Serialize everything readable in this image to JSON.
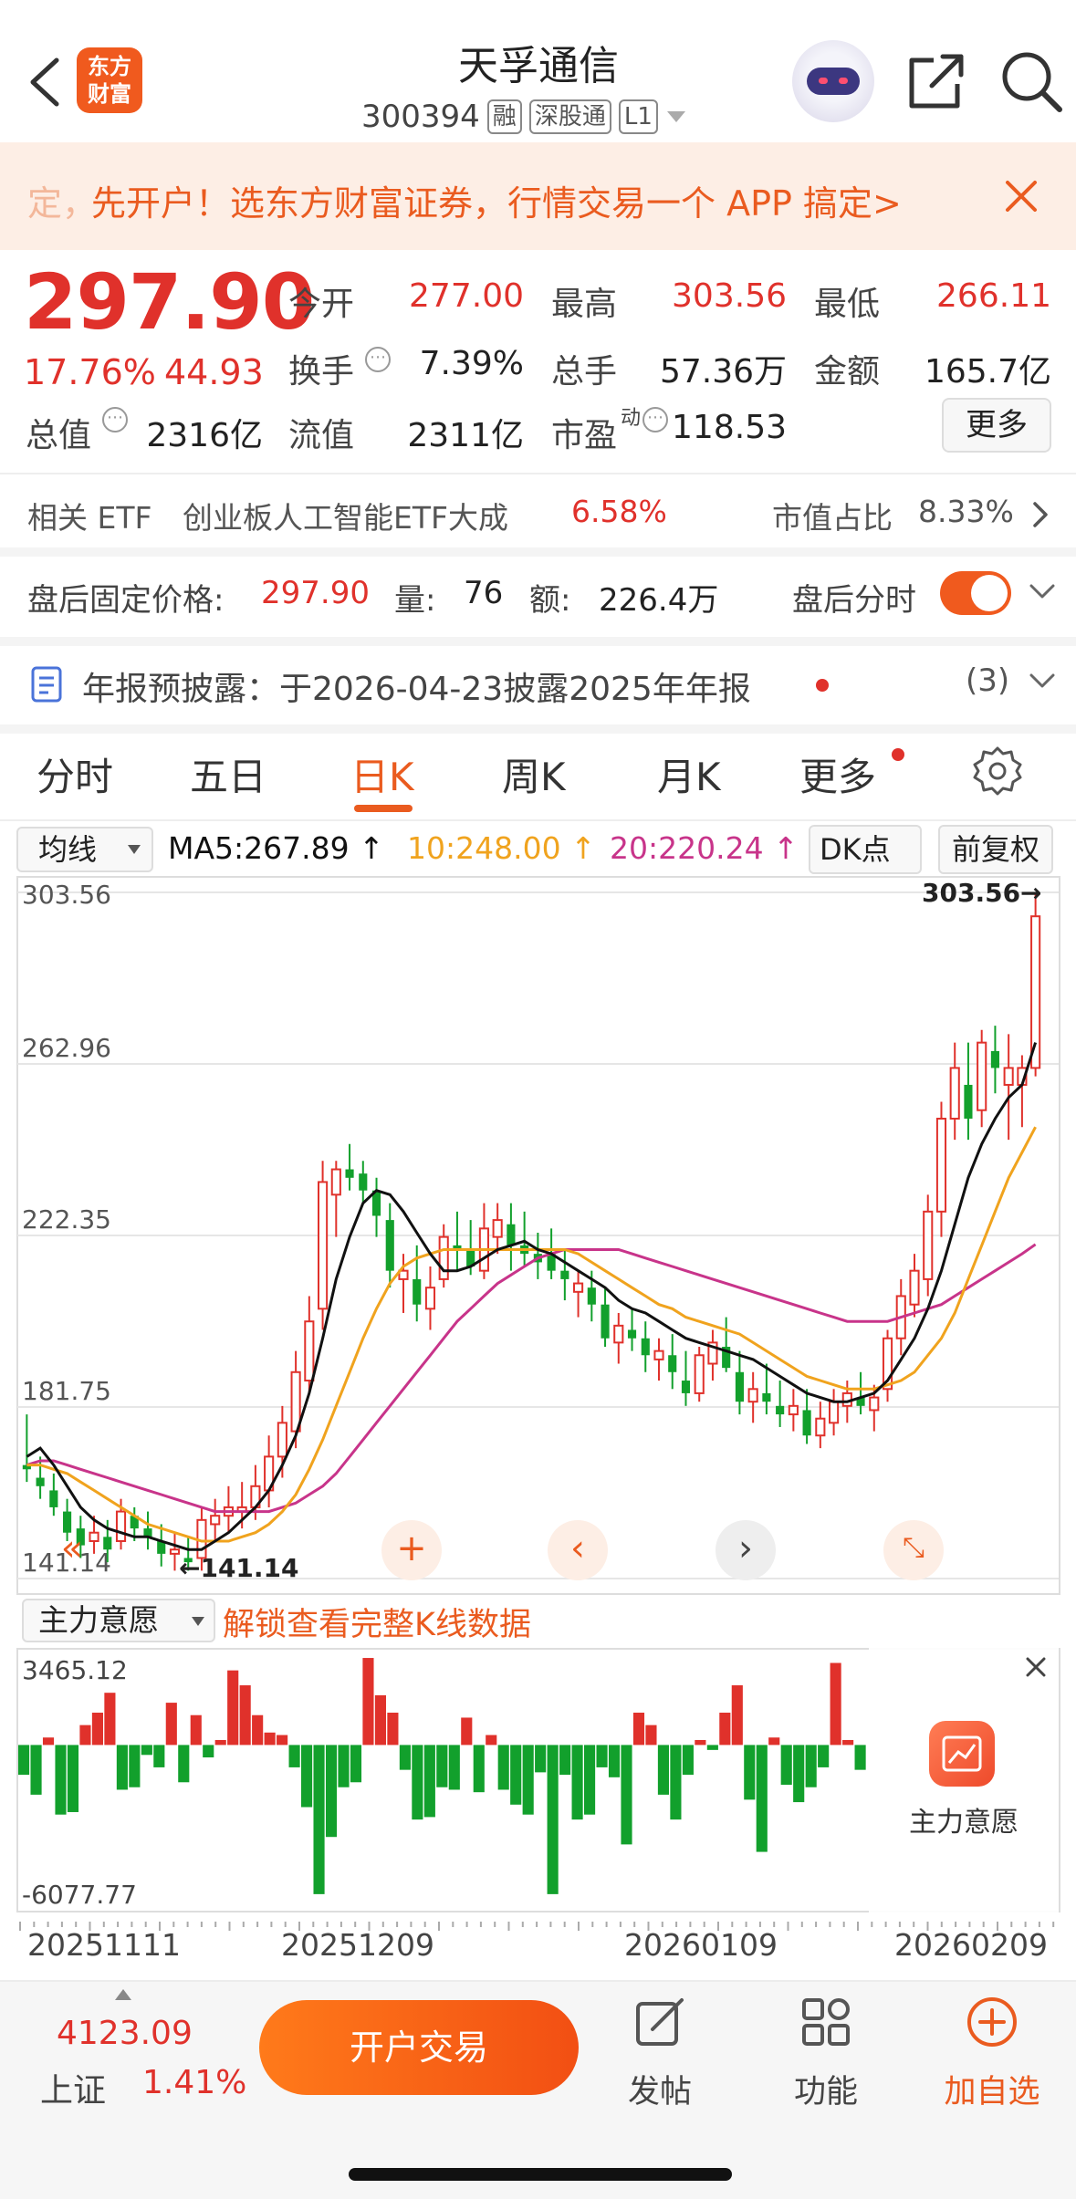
{
  "header": {
    "title": "天孚通信",
    "code": "300394",
    "tags": [
      "融",
      "深股通",
      "L1"
    ],
    "logo_text": [
      "东方",
      "财富"
    ]
  },
  "banner": {
    "text": "先开户！选东方财富证券，行情交易一个 APP 搞定>",
    "leading": "定，"
  },
  "quote": {
    "price": "297.90",
    "change_pct": "17.76%",
    "change_abs": "44.93",
    "fields": {
      "open_label": "今开",
      "open": "277.00",
      "high_label": "最高",
      "high": "303.56",
      "low_label": "最低",
      "low": "266.11",
      "turnover_label": "换手",
      "turnover": "7.39%",
      "volume_label": "总手",
      "volume": "57.36万",
      "amount_label": "金额",
      "amount": "165.7亿",
      "mcap_label": "总值",
      "mcap": "2316亿",
      "float_label": "流值",
      "float": "2311亿",
      "pe_label": "市盈",
      "pe_sup": "动",
      "pe": "118.53"
    },
    "more_label": "更多"
  },
  "etf": {
    "label": "相关 ETF",
    "name": "创业板人工智能ETF大成",
    "pct": "6.58%",
    "share_label": "市值占比",
    "share": "8.33%"
  },
  "after_hours": {
    "label": "盘后固定价格:",
    "price": "297.90",
    "vol_label": "量:",
    "vol": "76",
    "amt_label": "额:",
    "amt": "226.4万",
    "time_label": "盘后分时",
    "toggle_on": true
  },
  "report": {
    "text": "年报预披露：于2026-04-23披露2025年年报",
    "count": "(3)"
  },
  "tabs": [
    "分时",
    "五日",
    "日K",
    "周K",
    "月K",
    "更多"
  ],
  "active_tab": "日K",
  "ma_row": {
    "select": "均线",
    "ma5": "MA5:267.89",
    "ma10": "10:248.00",
    "ma20": "20:220.24",
    "dk_label": "DK点",
    "fq_label": "前复权"
  },
  "colors": {
    "accent": "#ea5b1f",
    "up": "#e0312b",
    "down": "#12a02c",
    "ma5": "#111111",
    "ma10": "#f0a31e",
    "ma20": "#c8348a"
  },
  "chart_data": {
    "type": "candlestick",
    "price_ticks": [
      "303.56",
      "262.96",
      "222.35",
      "181.75",
      "141.14"
    ],
    "ylim": [
      141.14,
      303.56
    ],
    "max_label": "303.56",
    "min_label": "141.14",
    "candles": [
      [
        167,
        180,
        164,
        168,
        "down"
      ],
      [
        165,
        170,
        160,
        163,
        "down"
      ],
      [
        162,
        166,
        156,
        158,
        "down"
      ],
      [
        157,
        160,
        150,
        152,
        "down"
      ],
      [
        153,
        156,
        146,
        149,
        "down"
      ],
      [
        150,
        156,
        147,
        152,
        "up"
      ],
      [
        151,
        155,
        145,
        148,
        "down"
      ],
      [
        150,
        160,
        148,
        157,
        "up"
      ],
      [
        156,
        158,
        150,
        153,
        "down"
      ],
      [
        153,
        157,
        148,
        151,
        "down"
      ],
      [
        150,
        154,
        144,
        147,
        "down"
      ],
      [
        147,
        152,
        143,
        148,
        "up"
      ],
      [
        146,
        151,
        143,
        145,
        "down"
      ],
      [
        146,
        158,
        143,
        155,
        "up"
      ],
      [
        154,
        160,
        150,
        156,
        "up"
      ],
      [
        156,
        163,
        152,
        158,
        "up"
      ],
      [
        157,
        164,
        153,
        158,
        "up"
      ],
      [
        158,
        168,
        155,
        163,
        "up"
      ],
      [
        162,
        175,
        158,
        170,
        "up"
      ],
      [
        170,
        182,
        165,
        178,
        "up"
      ],
      [
        176,
        195,
        172,
        190,
        "up"
      ],
      [
        188,
        208,
        185,
        202,
        "up"
      ],
      [
        205,
        240,
        200,
        235,
        "up"
      ],
      [
        232,
        240,
        222,
        238,
        "up"
      ],
      [
        238,
        244,
        233,
        236,
        "down"
      ],
      [
        237,
        240,
        230,
        233,
        "down"
      ],
      [
        233,
        236,
        222,
        227,
        "down"
      ],
      [
        226,
        230,
        210,
        214,
        "down"
      ],
      [
        214,
        218,
        204,
        212,
        "up"
      ],
      [
        212,
        220,
        202,
        206,
        "down"
      ],
      [
        205,
        215,
        200,
        210,
        "up"
      ],
      [
        212,
        225,
        210,
        222,
        "up"
      ],
      [
        220,
        228,
        214,
        219,
        "down"
      ],
      [
        219,
        226,
        213,
        215,
        "down"
      ],
      [
        214,
        230,
        212,
        224,
        "up"
      ],
      [
        222,
        230,
        218,
        226,
        "up"
      ],
      [
        225,
        230,
        214,
        220,
        "down"
      ],
      [
        220,
        228,
        215,
        218,
        "down"
      ],
      [
        218,
        223,
        212,
        216,
        "down"
      ],
      [
        218,
        224,
        212,
        214,
        "down"
      ],
      [
        214,
        219,
        207,
        212,
        "down"
      ],
      [
        211,
        214,
        203,
        209,
        "up"
      ],
      [
        210,
        214,
        202,
        206,
        "down"
      ],
      [
        206,
        210,
        196,
        198,
        "down"
      ],
      [
        197,
        204,
        192,
        201,
        "up"
      ],
      [
        200,
        205,
        195,
        198,
        "down"
      ],
      [
        198,
        202,
        190,
        194,
        "down"
      ],
      [
        193,
        198,
        188,
        195,
        "up"
      ],
      [
        194,
        199,
        186,
        190,
        "down"
      ],
      [
        188,
        195,
        182,
        185,
        "down"
      ],
      [
        185,
        196,
        183,
        194,
        "up"
      ],
      [
        192,
        200,
        188,
        197,
        "up"
      ],
      [
        196,
        203,
        190,
        191,
        "down"
      ],
      [
        190,
        195,
        180,
        183,
        "down"
      ],
      [
        183,
        190,
        178,
        186,
        "up"
      ],
      [
        185,
        192,
        180,
        183,
        "down"
      ],
      [
        182,
        188,
        177,
        180,
        "down"
      ],
      [
        180,
        186,
        176,
        182,
        "up"
      ],
      [
        181,
        186,
        173,
        175,
        "down"
      ],
      [
        175,
        183,
        172,
        179,
        "up"
      ],
      [
        178,
        186,
        175,
        183,
        "up"
      ],
      [
        182,
        188,
        178,
        185,
        "up"
      ],
      [
        184,
        190,
        180,
        182,
        "down"
      ],
      [
        181,
        187,
        176,
        184,
        "up"
      ],
      [
        186,
        200,
        183,
        198,
        "up"
      ],
      [
        198,
        212,
        194,
        208,
        "up"
      ],
      [
        206,
        218,
        203,
        214,
        "up"
      ],
      [
        212,
        232,
        208,
        228,
        "up"
      ],
      [
        228,
        254,
        222,
        250,
        "up"
      ],
      [
        250,
        268,
        245,
        262,
        "up"
      ],
      [
        258,
        268,
        245,
        250,
        "down"
      ],
      [
        252,
        271,
        248,
        268,
        "up"
      ],
      [
        266,
        272,
        256,
        262,
        "down"
      ],
      [
        262,
        270,
        245,
        258,
        "up"
      ],
      [
        258,
        265,
        248,
        262,
        "up"
      ],
      [
        262,
        303.56,
        260,
        297.9,
        "up"
      ]
    ],
    "ma5": [
      170,
      172,
      168,
      163,
      158,
      155,
      153,
      152,
      151,
      151,
      150,
      149,
      148,
      148,
      150,
      152,
      155,
      158,
      162,
      168,
      175,
      185,
      198,
      212,
      222,
      230,
      233,
      232,
      228,
      223,
      218,
      214,
      214,
      215,
      217,
      219,
      220,
      221,
      219,
      218,
      216,
      214,
      212,
      210,
      207,
      205,
      204,
      202,
      200,
      198,
      197,
      196,
      195,
      194,
      193,
      191,
      189,
      187,
      185,
      184,
      183,
      183,
      184,
      185,
      188,
      193,
      198,
      205,
      214,
      225,
      236,
      244,
      250,
      255,
      258,
      268
    ],
    "ma10": [
      168,
      168,
      167,
      166,
      164,
      162,
      160,
      158,
      156,
      154,
      153,
      152,
      151,
      150,
      150,
      150,
      151,
      152,
      154,
      157,
      161,
      167,
      174,
      182,
      190,
      198,
      205,
      211,
      215,
      217,
      218,
      219,
      219,
      219,
      219,
      219,
      219,
      219,
      219,
      219,
      219,
      218,
      216,
      214,
      212,
      210,
      208,
      206,
      205,
      203,
      202,
      201,
      200,
      199,
      197,
      195,
      193,
      191,
      189,
      188,
      187,
      186,
      186,
      186,
      187,
      188,
      190,
      194,
      198,
      204,
      212,
      220,
      228,
      236,
      242,
      248
    ],
    "ma20": [
      168,
      169,
      169,
      168,
      167,
      166,
      165,
      164,
      163,
      162,
      161,
      160,
      159,
      158,
      157,
      157,
      157,
      157,
      157,
      158,
      159,
      161,
      163,
      166,
      170,
      174,
      178,
      182,
      186,
      190,
      194,
      198,
      202,
      205,
      208,
      211,
      213,
      215,
      217,
      218,
      219,
      219,
      219,
      219,
      219,
      218,
      217,
      216,
      215,
      214,
      213,
      212,
      211,
      210,
      209,
      208,
      207,
      206,
      205,
      204,
      203,
      202,
      202,
      202,
      202,
      203,
      204,
      205,
      206,
      208,
      210,
      212,
      214,
      216,
      218,
      220.24
    ],
    "indicator": {
      "name": "主力意愿",
      "ylim": [
        -6077.77,
        3465.12
      ],
      "tick_max": "3465.12",
      "tick_min": "-6077.77",
      "values": [
        -1200,
        -2000,
        300,
        -2800,
        -2700,
        800,
        1300,
        2100,
        -1800,
        -1700,
        -400,
        -900,
        1700,
        -1500,
        1200,
        -500,
        200,
        3000,
        2400,
        1200,
        500,
        400,
        -900,
        -2500,
        -6000,
        -3700,
        -1700,
        -1500,
        3500,
        2000,
        1300,
        -1000,
        -3000,
        -2900,
        -1700,
        -1800,
        1100,
        -1900,
        400,
        -1800,
        -2400,
        -2800,
        -1100,
        -6000,
        -1200,
        -3000,
        -2800,
        -900,
        -1300,
        -4000,
        1300,
        800,
        -2000,
        -3000,
        -1200,
        200,
        -200,
        1300,
        2400,
        -2200,
        -4300,
        300,
        -1600,
        -2300,
        -1700,
        -900,
        3300,
        200,
        -1000
      ],
      "unlock_label": "解锁查看完整K线数据",
      "badge_label": "主力意愿"
    },
    "x_ticks": [
      "20251111",
      "20251209",
      "20260109",
      "20260209"
    ]
  },
  "bottom_bar": {
    "index_value": "4123.09",
    "index_name": "上证",
    "index_pct": "1.41%",
    "open_button": "开户交易",
    "items": [
      "发帖",
      "功能",
      "加自选"
    ]
  }
}
